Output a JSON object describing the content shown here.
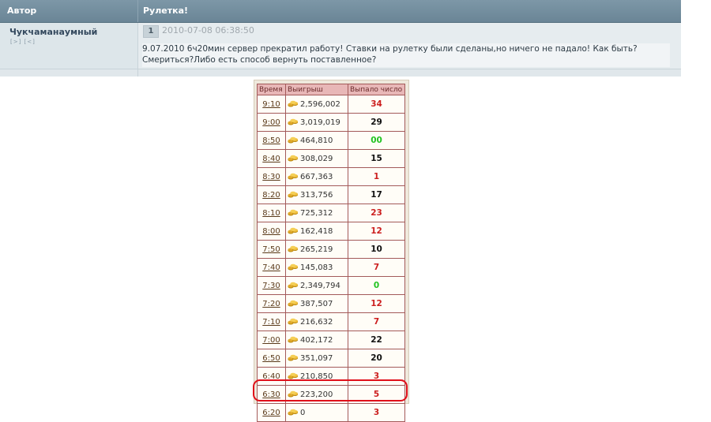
{
  "forum": {
    "header": {
      "author_label": "Автор",
      "topic_title": "Рулетка!"
    },
    "post": {
      "author": "Чукчаманаумный",
      "author_icons": "[>] [<]",
      "number": "1",
      "date": "2010-07-08 06:38:50",
      "text_line1": "9.07.2010 6ч20мин сервер прекратил работу! Ставки на рулетку были сделаны,но ничего не падало! Как быть?",
      "text_line2": "Смериться?Либо есть способ вернуть поставленное?"
    }
  },
  "roulette": {
    "headers": {
      "time": "Время",
      "win": "Выигрыш",
      "number": "Выпало число"
    },
    "colors": {
      "red": "#cc1f1f",
      "black": "#111111",
      "green": "#22c322",
      "highlight": "#e0101a",
      "header_bg": "#e8b7b7"
    },
    "rows": [
      {
        "time": "9:10",
        "win": "2,596,002",
        "number": "34",
        "color": "red"
      },
      {
        "time": "9:00",
        "win": "3,019,019",
        "number": "29",
        "color": "black"
      },
      {
        "time": "8:50",
        "win": "464,810",
        "number": "00",
        "color": "green"
      },
      {
        "time": "8:40",
        "win": "308,029",
        "number": "15",
        "color": "black"
      },
      {
        "time": "8:30",
        "win": "667,363",
        "number": "1",
        "color": "red"
      },
      {
        "time": "8:20",
        "win": "313,756",
        "number": "17",
        "color": "black"
      },
      {
        "time": "8:10",
        "win": "725,312",
        "number": "23",
        "color": "red"
      },
      {
        "time": "8:00",
        "win": "162,418",
        "number": "12",
        "color": "red"
      },
      {
        "time": "7:50",
        "win": "265,219",
        "number": "10",
        "color": "black"
      },
      {
        "time": "7:40",
        "win": "145,083",
        "number": "7",
        "color": "red"
      },
      {
        "time": "7:30",
        "win": "2,349,794",
        "number": "0",
        "color": "green"
      },
      {
        "time": "7:20",
        "win": "387,507",
        "number": "12",
        "color": "red"
      },
      {
        "time": "7:10",
        "win": "216,632",
        "number": "7",
        "color": "red"
      },
      {
        "time": "7:00",
        "win": "402,172",
        "number": "22",
        "color": "black"
      },
      {
        "time": "6:50",
        "win": "351,097",
        "number": "20",
        "color": "black"
      },
      {
        "time": "6:40",
        "win": "210,850",
        "number": "3",
        "color": "red"
      },
      {
        "time": "6:30",
        "win": "223,200",
        "number": "5",
        "color": "red"
      },
      {
        "time": "6:20",
        "win": "0",
        "number": "3",
        "color": "red",
        "highlighted": true
      }
    ]
  }
}
